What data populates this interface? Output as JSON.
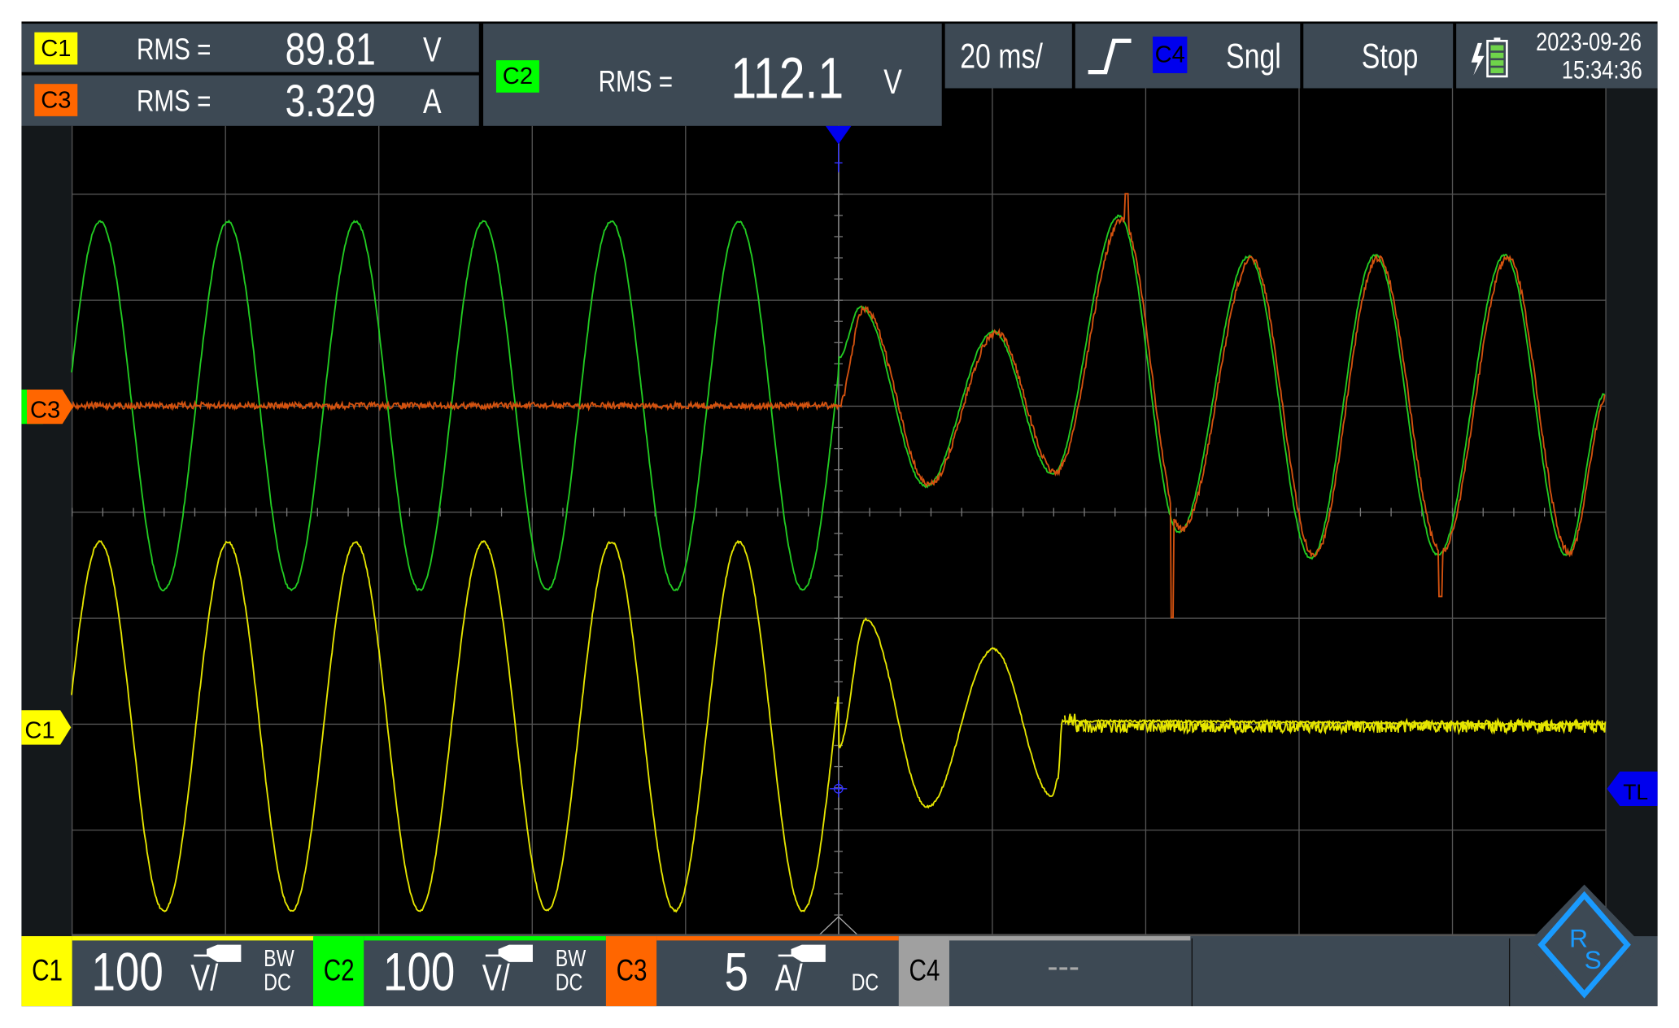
{
  "measurements": {
    "c1": {
      "channel": "C1",
      "label": "RMS =",
      "value": "89.81",
      "unit": "V"
    },
    "c3": {
      "channel": "C3",
      "label": "RMS =",
      "value": "3.329",
      "unit": "A"
    },
    "c2": {
      "channel": "C2",
      "label": "RMS =",
      "value": "112.1",
      "unit": "V"
    }
  },
  "timebase": "20 ms/",
  "trigger": {
    "source": "C4",
    "mode": "Sngl",
    "slope_icon": "rising-edge-icon"
  },
  "run_state": "Stop",
  "datetime": {
    "date": "2023-09-26",
    "time": "15:34:36"
  },
  "markers": {
    "c3": "C3",
    "c1": "C1",
    "trigger_level": "TL",
    "trigger_pos": "T"
  },
  "channels": [
    {
      "name": "C1",
      "scale": "100",
      "unit": "V/",
      "bw": "BW",
      "coupling": "DC",
      "color": "#ffff00"
    },
    {
      "name": "C2",
      "scale": "100",
      "unit": "V/",
      "bw": "BW",
      "coupling": "DC",
      "color": "#00ff00"
    },
    {
      "name": "C3",
      "scale": "5",
      "unit": "A/",
      "bw": "",
      "coupling": "DC",
      "color": "#ff6600"
    },
    {
      "name": "C4",
      "scale": "---",
      "color": "#a0a0a0"
    }
  ],
  "logo": "R&S",
  "traces": {
    "time_per_div_ms": 20,
    "c2_pre": {
      "freq_hz": 60,
      "amplitude_v": 174,
      "peak_time_ms": -96.3
    },
    "c2_post_extrema": [
      [
        0,
        45
      ],
      [
        2.9,
        93
      ],
      [
        11.4,
        -76
      ],
      [
        20.2,
        70
      ],
      [
        27.9,
        -64
      ],
      [
        36.6,
        179
      ],
      [
        44.4,
        -119
      ],
      [
        53.5,
        141
      ],
      [
        61.6,
        -144
      ],
      [
        70.0,
        142
      ],
      [
        78.2,
        -141
      ],
      [
        86.9,
        142
      ],
      [
        94.9,
        -141
      ],
      [
        100,
        12
      ]
    ],
    "c3_spikes_a": [
      [
        37.6,
        10
      ],
      [
        43.5,
        -10
      ],
      [
        78.5,
        -9
      ]
    ],
    "c1_pre": {
      "freq_hz": 60,
      "amplitude_v": 174,
      "peak_time_ms": -96.3
    },
    "c1_post_extrema": [
      [
        0,
        -20
      ],
      [
        3.6,
        101
      ],
      [
        11.6,
        -76
      ],
      [
        20.2,
        73
      ],
      [
        27.9,
        -66
      ],
      [
        28.6,
        -50
      ],
      [
        29.2,
        5
      ],
      [
        100,
        2
      ]
    ],
    "colors": {
      "c1": "#e6e600",
      "c2": "#22cc22",
      "c3": "#d4520f"
    }
  }
}
